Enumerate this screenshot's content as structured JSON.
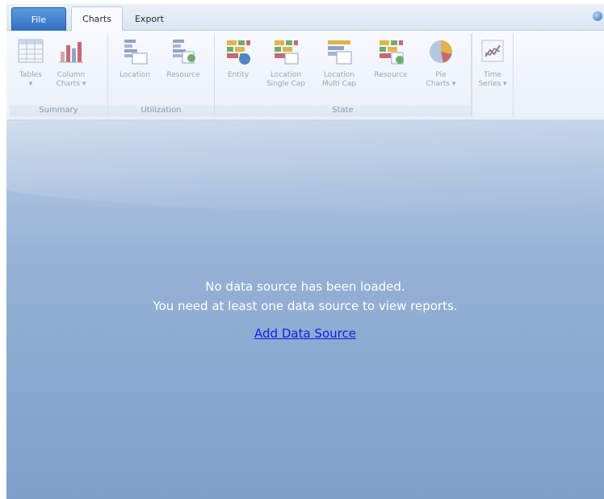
{
  "tabs": {
    "file": "File",
    "charts": "Charts",
    "export": "Export"
  },
  "ribbon": {
    "groups": {
      "summary": "Summary",
      "utilization": "Utilization",
      "state": "State"
    },
    "buttons": {
      "tables": "Tables\n▾",
      "column_charts": "Column\nCharts ▾",
      "location_util": "Location",
      "resource_util": "Resource",
      "entity": "Entity",
      "location_single": "Location\nSingle Cap",
      "location_multi": "Location\nMulti Cap",
      "resource_state": "Resource",
      "pie_charts": "Pie\nCharts ▾",
      "time_series": "Time\nSeries ▾"
    }
  },
  "main": {
    "line1": "No data source has been loaded.",
    "line2": "You need at least one data source to view reports.",
    "add_link": "Add Data Source"
  },
  "colors": {
    "accent": "#2f6fbf",
    "link": "#1a1ae6",
    "main_bg": "#94b0d4"
  }
}
